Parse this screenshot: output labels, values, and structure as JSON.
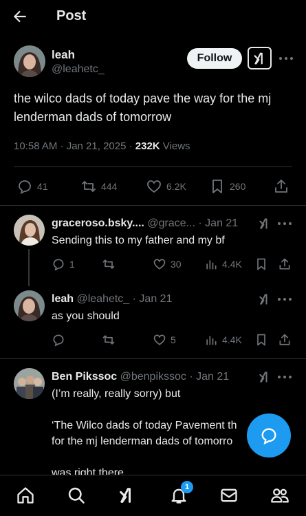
{
  "header": {
    "title": "Post"
  },
  "main_post": {
    "author_name": "leah",
    "author_handle": "@leahetc_",
    "follow_label": "Follow",
    "text": "the wilco dads of today pave the way for the mj lenderman dads of tomorrow",
    "time": "10:58 AM · Jan 21, 2025 · ",
    "views_count": "232K",
    "views_label": " Views",
    "replies": "41",
    "reposts": "444",
    "likes": "6.2K",
    "bookmarks": "260"
  },
  "replies": [
    {
      "name": "graceroso.bsky....",
      "handle": "@grace...",
      "date": "· Jan 21",
      "text": "Sending this to my father and my bf",
      "replies": "1",
      "reposts": "",
      "likes": "30",
      "views": "4.4K"
    },
    {
      "name": "leah",
      "handle": "@leahetc_",
      "date": "· Jan 21",
      "text": "as you should",
      "replies": "",
      "reposts": "",
      "likes": "5",
      "views": "4.4K"
    },
    {
      "name": "Ben Pikssoc",
      "handle": "@benpikssoc",
      "date": "· Jan 21",
      "text_line1": "(I’m really, really sorry) but",
      "text_line2": "‘The Wilco dads of today Pavement th",
      "text_line3": "for the mj lenderman dads of tomorro",
      "text_line4": "was right there"
    }
  ],
  "nav": {
    "notification_count": "1"
  },
  "colors": {
    "accent": "#1d9bf0",
    "muted": "#71767b",
    "text": "#e7e9ea"
  },
  "icons": [
    "back-arrow-icon",
    "grok-icon",
    "more-icon",
    "reply-icon",
    "repost-icon",
    "like-icon",
    "bookmark-icon",
    "share-icon",
    "views-icon",
    "home-icon",
    "search-icon",
    "bell-icon",
    "mail-icon",
    "people-icon",
    "compose-reply-icon"
  ]
}
